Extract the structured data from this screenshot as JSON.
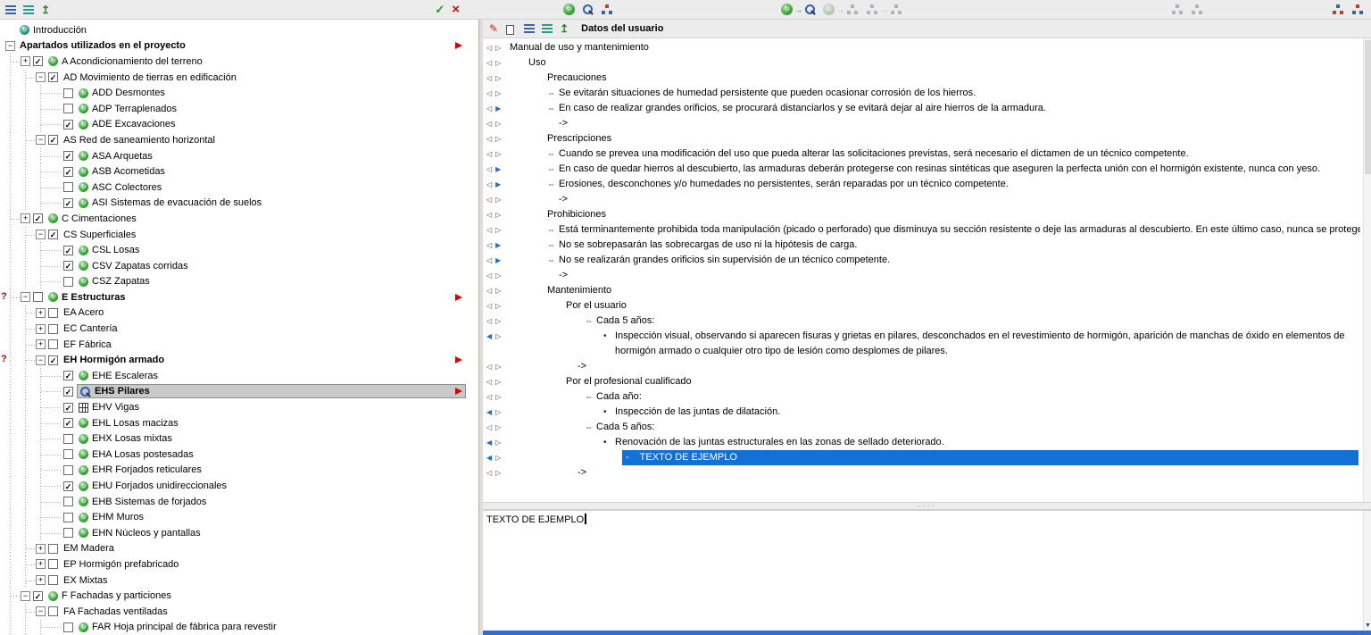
{
  "colors": {
    "selection_blue": "#1271d6",
    "selection_gray": "#c9c9c9",
    "flag_red": "#d90000",
    "section_green": "#2a9a2a",
    "focus_blue": "#2f6fd3"
  },
  "left_panel": {
    "toolbar": {
      "icons": [
        {
          "name": "outline-list-icon",
          "kind": "list-blue"
        },
        {
          "name": "content-list-icon",
          "kind": "list-teal"
        },
        {
          "name": "export-icon",
          "kind": "export"
        }
      ],
      "accept_label": "✓",
      "cancel_label": "×"
    },
    "tree": [
      {
        "label": "Introducción",
        "level": 0,
        "icon": "intro"
      },
      {
        "label": "Apartados utilizados en el proyecto",
        "level": 0,
        "exp": "-",
        "bold": true,
        "flag": true
      },
      {
        "label": "A Acondicionamiento del terreno",
        "level": 1,
        "exp": "+",
        "chk": true,
        "icon": "section"
      },
      {
        "label": "AD Movimiento de tierras en edificación",
        "level": 2,
        "exp": "-",
        "chk": true
      },
      {
        "label": "ADD Desmontes",
        "level": 3,
        "chk": false,
        "icon": "section"
      },
      {
        "label": "ADP Terraplenados",
        "level": 3,
        "chk": false,
        "icon": "section"
      },
      {
        "label": "ADE Excavaciones",
        "level": 3,
        "chk": true,
        "icon": "section"
      },
      {
        "label": "AS Red de saneamiento horizontal",
        "level": 2,
        "exp": "-",
        "chk": true
      },
      {
        "label": "ASA Arquetas",
        "level": 3,
        "chk": true,
        "icon": "section"
      },
      {
        "label": "ASB Acometidas",
        "level": 3,
        "chk": true,
        "icon": "section"
      },
      {
        "label": "ASC Colectores",
        "level": 3,
        "chk": false,
        "icon": "section"
      },
      {
        "label": "ASI Sistemas de evacuación de suelos",
        "level": 3,
        "chk": true,
        "icon": "section"
      },
      {
        "label": "C Cimentaciones",
        "level": 1,
        "exp": "+",
        "chk": true,
        "icon": "section"
      },
      {
        "label": "CS Superficiales",
        "level": 2,
        "exp": "-",
        "chk": true
      },
      {
        "label": "CSL Losas",
        "level": 3,
        "chk": true,
        "icon": "section"
      },
      {
        "label": "CSV Zapatas corridas",
        "level": 3,
        "chk": true,
        "icon": "section"
      },
      {
        "label": "CSZ Zapatas",
        "level": 3,
        "chk": false,
        "icon": "section"
      },
      {
        "label": "E Estructuras",
        "level": 1,
        "exp": "-",
        "chk": false,
        "icon": "section",
        "bold": true,
        "flag": true,
        "alert": true
      },
      {
        "label": "EA Acero",
        "level": 2,
        "exp": "+",
        "chk": false
      },
      {
        "label": "EC Cantería",
        "level": 2,
        "exp": "+",
        "chk": false
      },
      {
        "label": "EF Fábrica",
        "level": 2,
        "exp": "+",
        "chk": false
      },
      {
        "label": "EH Hormigón armado",
        "level": 2,
        "exp": "-",
        "chk": true,
        "bold": true,
        "flag": true,
        "alert": true
      },
      {
        "label": "EHE Escaleras",
        "level": 3,
        "chk": true,
        "icon": "section"
      },
      {
        "label": "EHS Pilares",
        "level": 3,
        "chk": true,
        "icon": "pilares",
        "bold": true,
        "sel": true,
        "flag": true
      },
      {
        "label": "EHV Vigas",
        "level": 3,
        "chk": true,
        "icon": "vigas"
      },
      {
        "label": "EHL Losas macizas",
        "level": 3,
        "chk": true,
        "icon": "section"
      },
      {
        "label": "EHX Losas mixtas",
        "level": 3,
        "chk": false,
        "icon": "section"
      },
      {
        "label": "EHA Losas postesadas",
        "level": 3,
        "chk": false,
        "icon": "section"
      },
      {
        "label": "EHR Forjados reticulares",
        "level": 3,
        "chk": false,
        "icon": "section"
      },
      {
        "label": "EHU Forjados unidireccionales",
        "level": 3,
        "chk": true,
        "icon": "section"
      },
      {
        "label": "EHB Sistemas de forjados",
        "level": 3,
        "chk": false,
        "icon": "section"
      },
      {
        "label": "EHM Muros",
        "level": 3,
        "chk": false,
        "icon": "section"
      },
      {
        "label": "EHN Núcleos y pantallas",
        "level": 3,
        "chk": false,
        "icon": "section"
      },
      {
        "label": "EM Madera",
        "level": 2,
        "exp": "+",
        "chk": false
      },
      {
        "label": "EP Hormigón prefabricado",
        "level": 2,
        "exp": "+",
        "chk": false
      },
      {
        "label": "EX Mixtas",
        "level": 2,
        "exp": "+",
        "chk": false
      },
      {
        "label": "F Fachadas y particiones",
        "level": 1,
        "exp": "-",
        "chk": true,
        "icon": "section"
      },
      {
        "label": "FA Fachadas ventiladas",
        "level": 2,
        "exp": "-",
        "chk": false
      },
      {
        "label": "FAR Hoja principal de fábrica para revestir",
        "level": 3,
        "chk": false,
        "icon": "section"
      }
    ]
  },
  "right_panel": {
    "toolbar_groups": {
      "view": [
        {
          "name": "update-section-icon",
          "kind": "sphere"
        },
        {
          "name": "find-in-tree-icon",
          "kind": "mag"
        },
        {
          "name": "tree-diagram-icon",
          "kind": "tree"
        }
      ],
      "copy": [
        {
          "name": "copy-section-to-tree-icon",
          "kind": "sphere,arrow,mag"
        },
        {
          "name": "copy-section-to-all-icon",
          "kind": "sphere,arrow,tree",
          "disabled": true
        },
        {
          "name": "copy-tree-to-tree-icon",
          "kind": "tree,arrow,tree",
          "disabled": true
        }
      ],
      "tools_disabled": [
        {
          "name": "tree-edit-icon",
          "kind": "tree",
          "disabled": true
        },
        {
          "name": "tree-clear-icon",
          "kind": "tree-red",
          "disabled": true
        }
      ],
      "tools": [
        {
          "name": "tree-replace-icon",
          "kind": "tree-red"
        },
        {
          "name": "tree-config-icon",
          "kind": "tree"
        }
      ]
    },
    "header": {
      "icons": [
        {
          "name": "edit-icon",
          "kind": "edit"
        },
        {
          "name": "copy-icon",
          "kind": "copy"
        },
        {
          "name": "outline-list-icon",
          "kind": "list-blue"
        },
        {
          "name": "content-list-icon",
          "kind": "list-teal"
        },
        {
          "name": "export-icon",
          "kind": "export"
        }
      ],
      "title": "Datos del usuario"
    },
    "outline": [
      {
        "text": "Manual de uso y mantenimiento",
        "level": 0
      },
      {
        "text": "Uso",
        "level": 1
      },
      {
        "text": "Precauciones",
        "level": 2
      },
      {
        "text": "Se evitarán situaciones de humedad persistente que pueden ocasionar corrosión de los hierros.",
        "level": 2,
        "bullet": "link"
      },
      {
        "text": "En caso de realizar grandes orificios, se procurará distanciarlos y se evitará dejar al aire hierros de la armadura.",
        "level": 2,
        "bullet": "link",
        "r": "f"
      },
      {
        "text": "->",
        "level": 2,
        "bullet": "none"
      },
      {
        "text": "Prescripciones",
        "level": 2
      },
      {
        "text": "Cuando se prevea una modificación del uso que pueda alterar las solicitaciones previstas, será necesario el dictamen de un técnico competente.",
        "level": 2,
        "bullet": "link"
      },
      {
        "text": "En caso de quedar hierros al descubierto, las armaduras deberán protegerse con resinas sintéticas que aseguren la perfecta unión con el hormigón existente, nunca con yeso.",
        "level": 2,
        "bullet": "link",
        "r": "f"
      },
      {
        "text": "Erosiones, desconchones y/o humedades no persistentes, serán reparadas por un técnico competente.",
        "level": 2,
        "bullet": "link",
        "r": "f"
      },
      {
        "text": "->",
        "level": 2,
        "bullet": "none"
      },
      {
        "text": "Prohibiciones",
        "level": 2
      },
      {
        "text": "Está terminantemente prohibida toda manipulación (picado o perforado) que disminuya su sección resistente o deje las armaduras al descubierto. En este último caso, nunca se protegerán con yeso las armaduras.",
        "level": 2,
        "bullet": "link"
      },
      {
        "text": "No se sobrepasarán las sobrecargas de uso ni la hipótesis de carga.",
        "level": 2,
        "bullet": "link",
        "r": "f"
      },
      {
        "text": "No se realizarán grandes orificios sin supervisión de un técnico competente.",
        "level": 2,
        "bullet": "link",
        "r": "f"
      },
      {
        "text": "->",
        "level": 2,
        "bullet": "none"
      },
      {
        "text": "Mantenimiento",
        "level": 2
      },
      {
        "text": "Por el usuario",
        "level": 3
      },
      {
        "text": "Cada 5 años:",
        "level": 4,
        "bullet": "link"
      },
      {
        "text": "Inspección visual, observando si aparecen fisuras y grietas en pilares, desconchados en el revestimiento de hormigón, aparición de manchas de óxido en elementos de hormigón armado o cualquier otro tipo de lesión como desplomes de pilares.",
        "level": 5,
        "bullet": "dot",
        "l": "f",
        "wrap": true
      },
      {
        "text": "->",
        "level": 3,
        "bullet": "none"
      },
      {
        "text": "Por el profesional cualificado",
        "level": 3
      },
      {
        "text": "Cada año:",
        "level": 4,
        "bullet": "link"
      },
      {
        "text": "Inspección de las juntas de dilatación.",
        "level": 5,
        "bullet": "dot",
        "l": "f"
      },
      {
        "text": "Cada 5 años:",
        "level": 4,
        "bullet": "link"
      },
      {
        "text": "Renovación de las juntas estructurales en las zonas de sellado deteriorado.",
        "level": 5,
        "bullet": "dot",
        "l": "f"
      },
      {
        "text": "TEXTO DE EJEMPLO",
        "level": 6,
        "sel": true,
        "prefix": "-",
        "l": "f"
      },
      {
        "text": "->",
        "level": 3,
        "bullet": "none"
      }
    ],
    "splitter_dots": "····",
    "editor": {
      "text": "TEXTO DE EJEMPLO"
    }
  }
}
